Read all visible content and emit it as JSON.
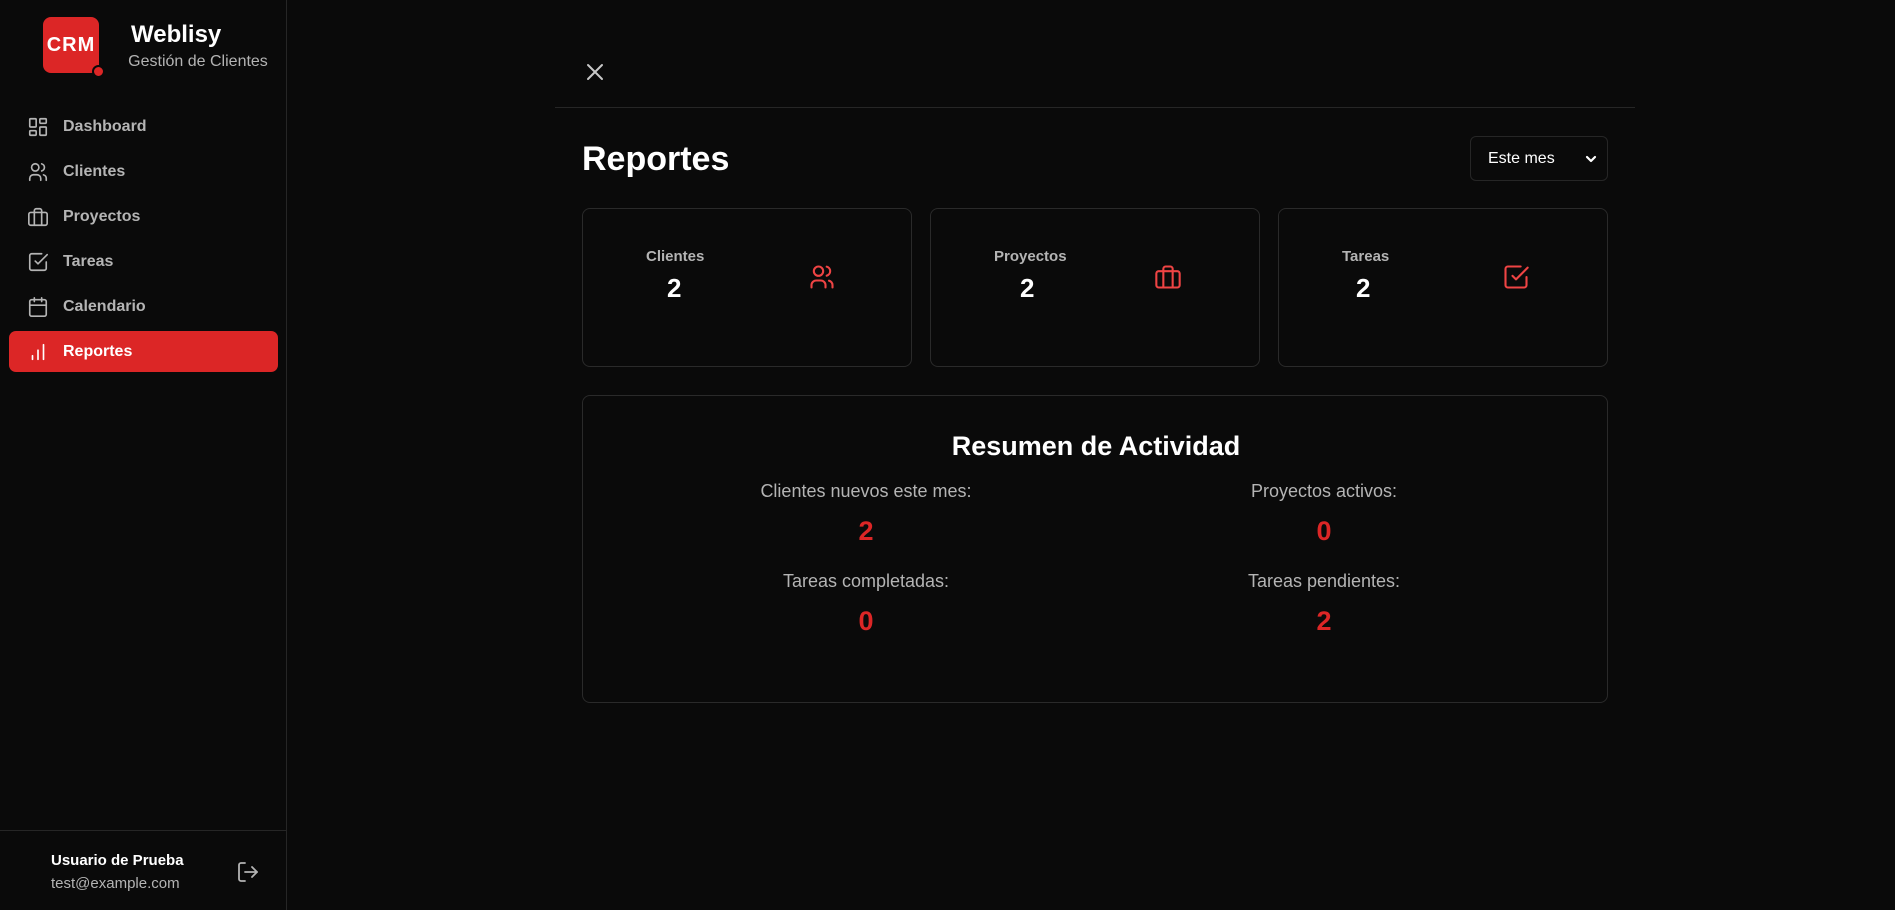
{
  "brand": {
    "logo_text": "CRM",
    "name": "Weblisy",
    "subtitle": "Gestión de Clientes",
    "accent_color": "#dc2626"
  },
  "nav": {
    "items": [
      {
        "label": "Dashboard",
        "icon": "dashboard-icon",
        "active": false
      },
      {
        "label": "Clientes",
        "icon": "users-icon",
        "active": false
      },
      {
        "label": "Proyectos",
        "icon": "briefcase-icon",
        "active": false
      },
      {
        "label": "Tareas",
        "icon": "check-square-icon",
        "active": false
      },
      {
        "label": "Calendario",
        "icon": "calendar-icon",
        "active": false
      },
      {
        "label": "Reportes",
        "icon": "bar-chart-icon",
        "active": true
      }
    ]
  },
  "user": {
    "name": "Usuario de Prueba",
    "email": "test@example.com",
    "logout_icon": "logout-icon"
  },
  "page": {
    "title": "Reportes",
    "close_icon": "close-icon",
    "period": {
      "selected": "Este mes",
      "icon": "chevron-down-icon"
    }
  },
  "stats": [
    {
      "label": "Clientes",
      "value": "2",
      "icon": "users-icon"
    },
    {
      "label": "Proyectos",
      "value": "2",
      "icon": "briefcase-icon"
    },
    {
      "label": "Tareas",
      "value": "2",
      "icon": "check-square-icon"
    }
  ],
  "summary": {
    "title": "Resumen de Actividad",
    "items": [
      {
        "label": "Clientes nuevos este mes:",
        "value": "2"
      },
      {
        "label": "Proyectos activos:",
        "value": "0"
      },
      {
        "label": "Tareas completadas:",
        "value": "0"
      },
      {
        "label": "Tareas pendientes:",
        "value": "2"
      }
    ]
  }
}
